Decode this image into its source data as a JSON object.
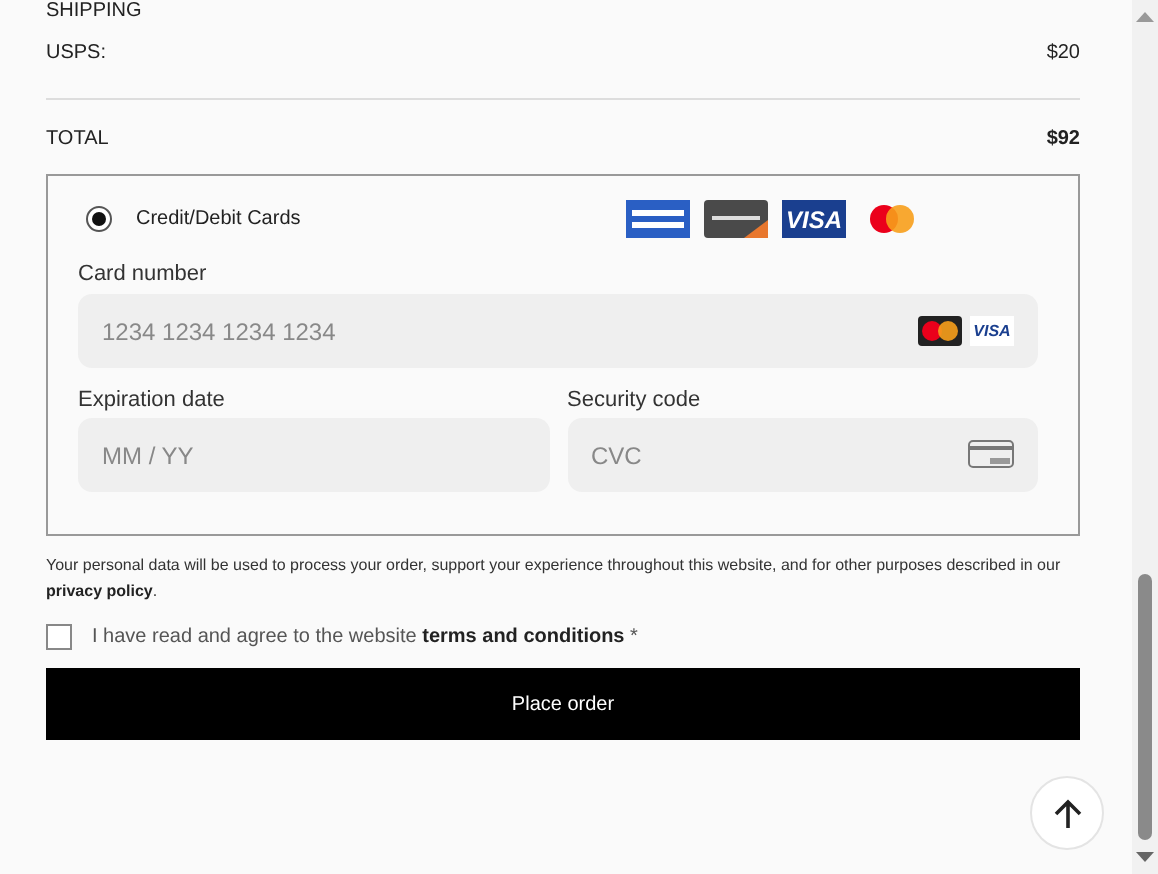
{
  "shipping": {
    "heading": "SHIPPING",
    "method": "USPS:",
    "price": "$20"
  },
  "total": {
    "label": "TOTAL",
    "amount": "$92"
  },
  "payment": {
    "option": {
      "label": "Credit/Debit Cards",
      "selected": true
    },
    "logos": [
      {
        "kind": "amex"
      },
      {
        "kind": "discover"
      },
      {
        "kind": "visa",
        "label": "VISA"
      },
      {
        "kind": "mastercard"
      }
    ],
    "card_number": {
      "label": "Card number",
      "placeholder": "1234 1234 1234 1234",
      "logos": [
        {
          "kind": "mastercard"
        },
        {
          "kind": "visa",
          "label": "VISA"
        }
      ]
    },
    "expiry": {
      "label": "Expiration date",
      "placeholder": "MM / YY"
    },
    "cvc": {
      "label": "Security code",
      "placeholder": "CVC"
    }
  },
  "privacy_notice": "Your personal data will be used to process your order, support your experience throughout this website, and for other purposes described in our",
  "privacy_link": "privacy policy",
  "privacy_end": ".",
  "terms": {
    "text": "I have read and agree to the website",
    "link": "terms and conditions",
    "required_mark": "*",
    "checked": false
  },
  "place_order": "Place order"
}
